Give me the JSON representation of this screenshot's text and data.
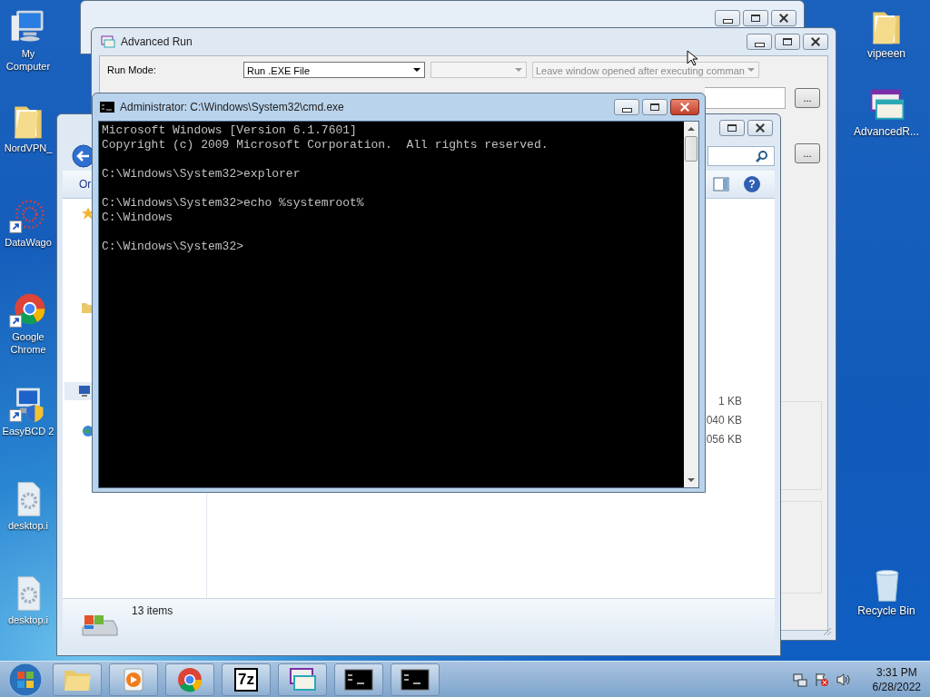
{
  "desktop_icons_left": [
    {
      "label": "My Computer",
      "kind": "computer",
      "shortcut": false
    },
    {
      "label": "NordVPN_",
      "kind": "folder",
      "shortcut": false
    },
    {
      "label": "DataWago",
      "kind": "dots",
      "shortcut": true
    },
    {
      "label": "Google Chrome",
      "kind": "chrome",
      "shortcut": true
    },
    {
      "label": "EasyBCD 2",
      "kind": "monitor",
      "shortcut": true
    },
    {
      "label": "desktop.i",
      "kind": "file",
      "shortcut": false
    },
    {
      "label": "desktop.i",
      "kind": "file",
      "shortcut": false
    }
  ],
  "desktop_icons_right": [
    {
      "label": "vipeeen",
      "kind": "folder",
      "shortcut": false
    },
    {
      "label": "AdvancedR...",
      "kind": "app",
      "shortcut": false
    },
    {
      "label": "Recycle Bin",
      "kind": "bin",
      "shortcut": false
    }
  ],
  "advanced_run": {
    "title": "Advanced Run",
    "run_mode_label": "Run Mode:",
    "run_mode_value": "Run .EXE File",
    "window_option": "Leave window opened after executing comman",
    "browse_buttons": [
      "...",
      "..."
    ]
  },
  "explorer": {
    "toolbar_text": "Or",
    "help_label": "?",
    "sizes": [
      "1 KB",
      "040 KB",
      "056 KB"
    ],
    "status": "13 items"
  },
  "cmd": {
    "title": "Administrator: C:\\Windows\\System32\\cmd.exe",
    "blocks": [
      [
        "Microsoft Windows [Version 6.1.7601]",
        "Copyright (c) 2009 Microsoft Corporation.  All rights reserved."
      ],
      [
        "C:\\Windows\\System32>explorer"
      ],
      [
        "C:\\Windows\\System32>echo %systemroot%",
        "C:\\Windows"
      ],
      [
        "C:\\Windows\\System32>"
      ]
    ]
  },
  "taskbar": {
    "apps": [
      {
        "kind": "folder"
      },
      {
        "kind": "media"
      },
      {
        "kind": "chrome"
      },
      {
        "kind": "archiver",
        "label": "7z"
      },
      {
        "kind": "app"
      },
      {
        "kind": "console"
      },
      {
        "kind": "console"
      }
    ],
    "time": "3:31 PM",
    "date": "6/28/2022"
  }
}
